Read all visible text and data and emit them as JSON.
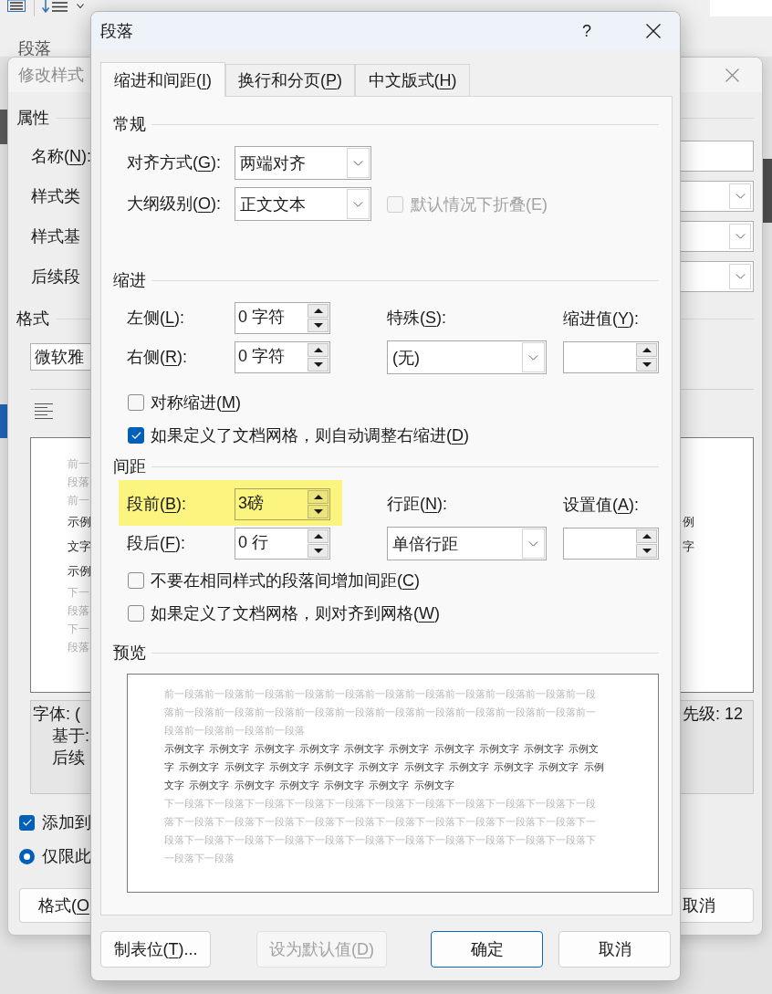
{
  "word_window": {
    "ribbon_group_label": "段落"
  },
  "modify_style_dialog": {
    "title": "修改样式",
    "properties_heading": "属性",
    "properties": [
      {
        "label": "名称(N):",
        "kind": "text"
      },
      {
        "label": "样式类",
        "kind": "dropdown"
      },
      {
        "label": "样式基",
        "kind": "dropdown"
      },
      {
        "label": "后续段",
        "kind": "dropdown"
      }
    ],
    "format_heading": "格式",
    "font_field": "微软雅",
    "preview_rows": [
      {
        "left": "前一",
        "kind": "context"
      },
      {
        "left": "段落",
        "kind": "context"
      },
      {
        "left": "前一",
        "kind": "context"
      },
      {
        "left": "示例",
        "right": "例",
        "kind": "sample"
      },
      {
        "left": "文字",
        "right": "字",
        "kind": "sample"
      },
      {
        "left": "示例",
        "kind": "sample"
      },
      {
        "left": "下一",
        "kind": "context"
      },
      {
        "left": "段落",
        "kind": "context"
      },
      {
        "left": "下一",
        "kind": "context"
      },
      {
        "left": "段落",
        "kind": "context"
      }
    ],
    "description_left": [
      "字体: (",
      "基于:",
      "后续"
    ],
    "description_right": "先级: 12",
    "add_to_template": {
      "label": "添加到",
      "checked": true
    },
    "scope": {
      "label": "仅限此",
      "selected": true
    },
    "format_button": "格式(O",
    "cancel_button": "取消"
  },
  "paragraph_dialog": {
    "title": "段落",
    "help_button": "?",
    "tabs": [
      {
        "label": "缩进和间距(I)",
        "selected": true
      },
      {
        "label": "换行和分页(P)",
        "selected": false
      },
      {
        "label": "中文版式(H)",
        "selected": false
      }
    ],
    "general": {
      "heading": "常规",
      "alignment": {
        "label": "对齐方式(G):",
        "value": "两端对齐"
      },
      "outline_level": {
        "label": "大纲级别(O):",
        "value": "正文文本"
      },
      "collapse_by_default": {
        "label": "默认情况下折叠(E)",
        "checked": false,
        "disabled": true
      }
    },
    "indentation": {
      "heading": "缩进",
      "left": {
        "label": "左侧(L):",
        "value": "0 字符"
      },
      "right": {
        "label": "右侧(R):",
        "value": "0 字符"
      },
      "special": {
        "label": "特殊(S):",
        "value": "(无)"
      },
      "by": {
        "label": "缩进值(Y):"
      },
      "options": [
        {
          "label": "对称缩进(M)",
          "checked": false
        },
        {
          "label": "如果定义了文档网格，则自动调整右缩进(D)",
          "checked": true
        }
      ]
    },
    "spacing": {
      "heading": "间距",
      "before": {
        "label": "段前(B):",
        "value": "3磅",
        "highlighted": true
      },
      "after": {
        "label": "段后(F):",
        "value": "0 行"
      },
      "line_spacing": {
        "label": "行距(N):",
        "value": "单倍行距"
      },
      "at": {
        "label": "设置值(A):"
      },
      "options": [
        {
          "label": "不要在相同样式的段落间增加间距(C)",
          "checked": false
        },
        {
          "label": "如果定义了文档网格，则对齐到网格(W)",
          "checked": false
        }
      ]
    },
    "preview": {
      "heading": "预览",
      "previous_paragraph": "前一段落前一段落前一段落前一段落前一段落前一段落前一段落前一段落前一段落前一段落前一段落前一段落前一段落前一段落前一段落前一段落前一段落前一段落前一段落前一段落前一段落前一段落前一段落前一段落前一段落",
      "sample_text": "示例文字 示例文字 示例文字 示例文字 示例文字 示例文字 示例文字 示例文字 示例文字 示例文字 示例文字 示例文字 示例文字 示例文字 示例文字 示例文字 示例文字 示例文字 示例文字 示例文字 示例文字 示例文字 示例文字 示例文字 示例文字 示例文字",
      "next_paragraph": "下一段落下一段落下一段落下一段落下一段落下一段落下一段落下一段落下一段落下一段落下一段落下一段落下一段落下一段落下一段落下一段落下一段落下一段落下一段落下一段落下一段落下一段落下一段落下一段落下一段落下一段落下一段落下一段落下一段落下一段落下一段落下一段落下一段落下一段落"
    },
    "buttons": [
      {
        "label": "制表位(T)...",
        "kind": "normal"
      },
      {
        "label": "设为默认值(D)",
        "kind": "disabled"
      },
      {
        "label": "确定",
        "kind": "default"
      },
      {
        "label": "取消",
        "kind": "normal"
      }
    ]
  }
}
